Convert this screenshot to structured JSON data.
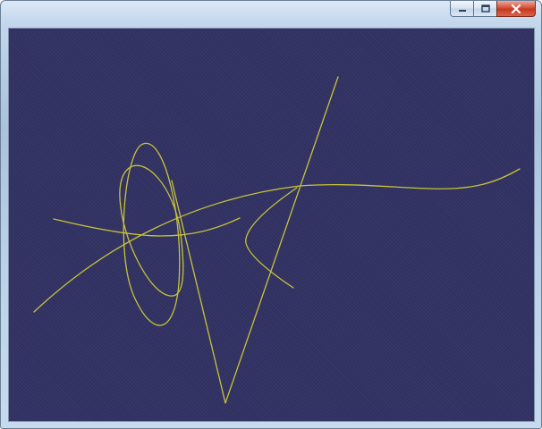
{
  "window": {
    "title": "",
    "caption_buttons": [
      {
        "name": "minimize",
        "icon": "minimize-icon"
      },
      {
        "name": "maximize",
        "icon": "maximize-icon"
      },
      {
        "name": "close",
        "icon": "close-icon"
      }
    ]
  },
  "viewport": {
    "background_color": "#313263",
    "curve_color": "#c8c23a",
    "curves": [
      "large-tilted-ellipse",
      "small-tilted-ellipse",
      "hyperbola-branch-left",
      "hyperbola-branch-right",
      "long-spline-curve",
      "v-polyline"
    ]
  }
}
